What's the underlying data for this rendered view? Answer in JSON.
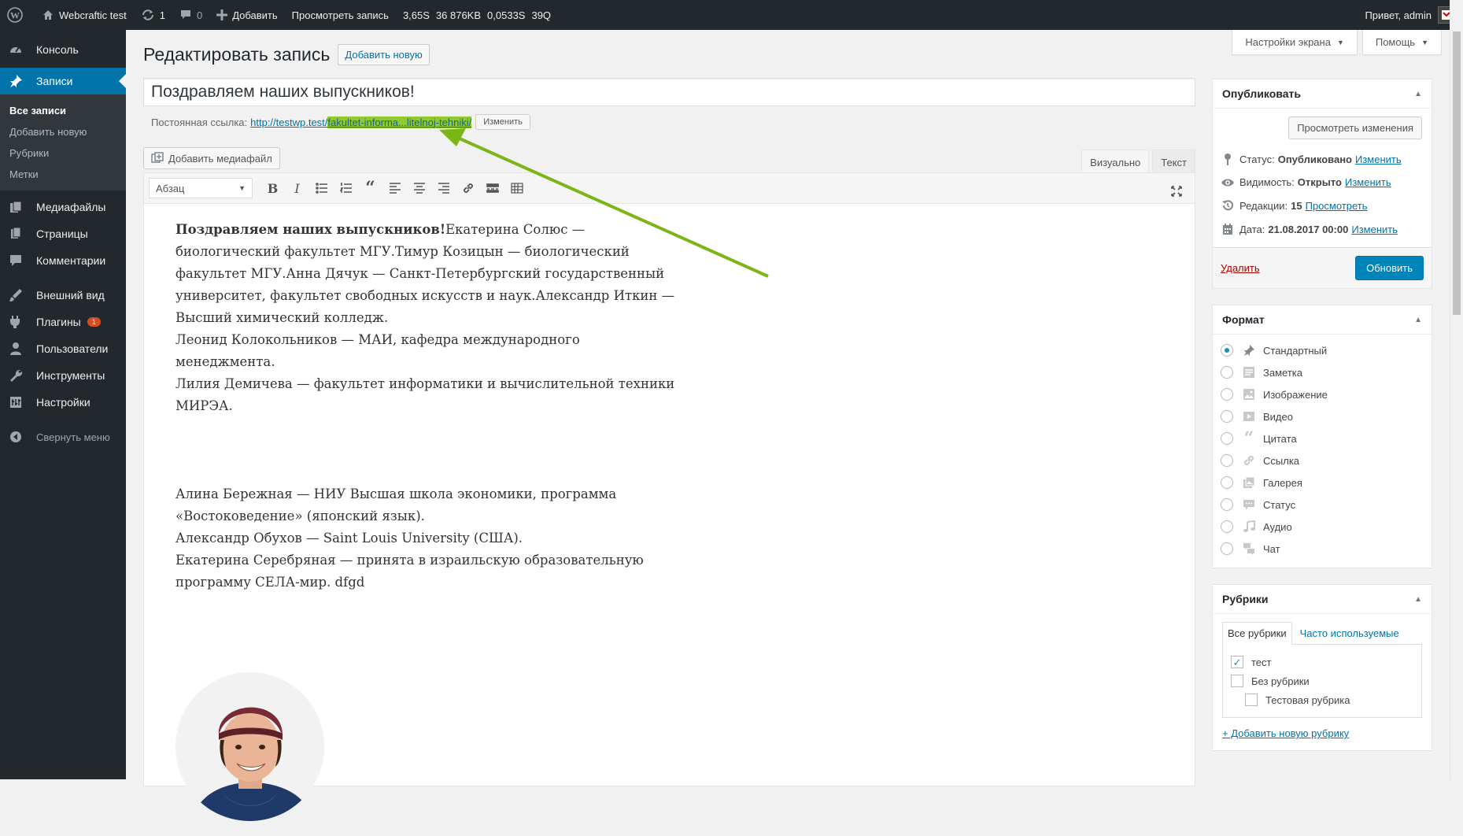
{
  "adminbar": {
    "site_name": "Webcraftic test",
    "updates_count": "1",
    "comments_count": "0",
    "add_new": "Добавить",
    "view_post": "Просмотреть запись",
    "stat_time": "3,65S",
    "stat_memory": "36 876KB",
    "stat_query_time": "0,0533S",
    "stat_queries": "39Q",
    "greeting": "Привет, admin"
  },
  "sidebar": {
    "console": "Консоль",
    "posts": "Записи",
    "posts_sub": [
      "Все записи",
      "Добавить новую",
      "Рубрики",
      "Метки"
    ],
    "media": "Медиафайлы",
    "pages": "Страницы",
    "comments": "Комментарии",
    "appearance": "Внешний вид",
    "plugins": "Плагины",
    "plugins_badge": "1",
    "users": "Пользователи",
    "tools": "Инструменты",
    "settings": "Настройки",
    "collapse": "Свернуть меню"
  },
  "header": {
    "screen_options": "Настройки экрана",
    "help": "Помощь",
    "page_title": "Редактировать запись",
    "add_new_button": "Добавить новую"
  },
  "post": {
    "title": "Поздравляем наших выпускников!",
    "permalink_label": "Постоянная ссылка:",
    "permalink_base": "http://testwp.test/",
    "permalink_slug": "fakultet-informa...litelnoj-tehniki/",
    "edit_permalink": "Изменить",
    "add_media": "Добавить медиафайл",
    "tab_visual": "Визуально",
    "tab_text": "Текст",
    "format_select": "Абзац"
  },
  "content": {
    "p1_bold": "Поздравляем наших выпускников!",
    "p1_rest": "Екатерина Солюс — биологический факультет МГУ.Тимур Козицын — биологический факультет МГУ.Анна Дячук — Санкт-Петербургский государственный университет, факультет свободных искусств и наук.Александр Иткин — Высший химический колледж.",
    "p2": "Леонид Колокольников — МАИ, кафедра международного менеджмента.",
    "p3": "Лилия Демичева — факультет информатики и вычислительной техники МИРЭА.",
    "p4": "Алина Бережная — НИУ Высшая школа экономики, программа «Востоковедение» (японский язык).",
    "p5": "Александр Обухов — Saint Louis University (США).",
    "p6": "Екатерина Серебряная — принята в израильскую образовательную программу СЕЛА-мир. dfgd"
  },
  "publish": {
    "title": "Опубликовать",
    "preview_button": "Просмотреть изменения",
    "status_label": "Статус:",
    "status_value": "Опубликовано",
    "visibility_label": "Видимость:",
    "visibility_value": "Открыто",
    "revisions_label": "Редакции:",
    "revisions_value": "15",
    "revisions_link": "Просмотреть",
    "date_label": "Дата:",
    "date_value": "21.08.2017 00:00",
    "edit_link": "Изменить",
    "delete_link": "Удалить",
    "update_button": "Обновить"
  },
  "format_box": {
    "title": "Формат",
    "options": [
      "Стандартный",
      "Заметка",
      "Изображение",
      "Видео",
      "Цитата",
      "Ссылка",
      "Галерея",
      "Статус",
      "Аудио",
      "Чат"
    ],
    "selected": "Стандартный"
  },
  "categories_box": {
    "title": "Рубрики",
    "tab_all": "Все рубрики",
    "tab_popular": "Часто используемые",
    "items": [
      "тест",
      "Без рубрики",
      "Тестовая рубрика"
    ],
    "checked": [
      "тест"
    ],
    "add_link": "+ Добавить новую рубрику"
  },
  "colors": {
    "accent": "#0073aa",
    "primary_button": "#0085ba",
    "adminbar_bg": "#23282d",
    "permalink_highlight": "#8fcb2e",
    "annotation_arrow": "#7cb518"
  }
}
